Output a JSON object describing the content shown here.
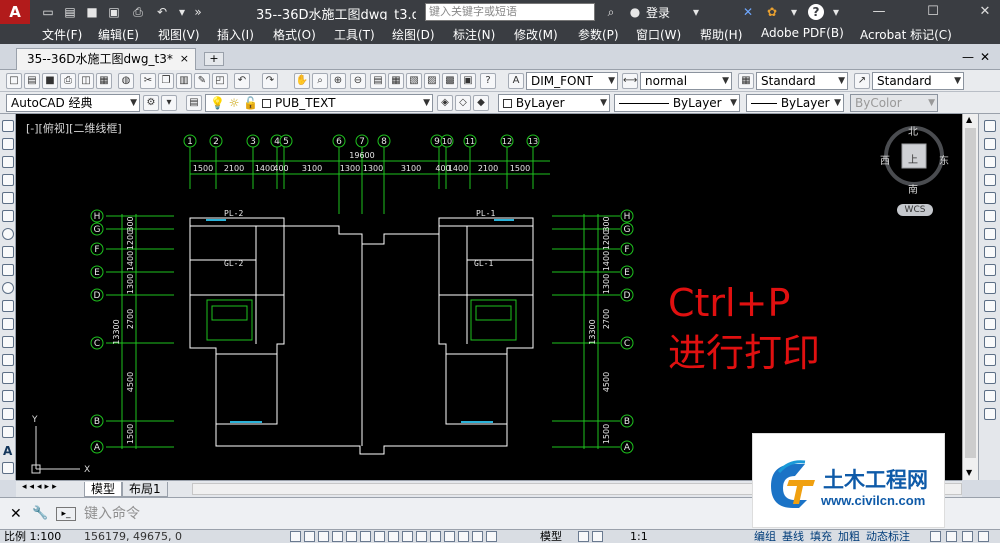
{
  "app": {
    "icon_letter": "A",
    "document_title": "35--36D水施工图dwg_t3.d...",
    "search_placeholder": "键入关键字或短语",
    "sign_in": "登录"
  },
  "menu": [
    "文件(F)",
    "编辑(E)",
    "视图(V)",
    "插入(I)",
    "格式(O)",
    "工具(T)",
    "绘图(D)",
    "标注(N)",
    "修改(M)",
    "参数(P)",
    "窗口(W)",
    "帮助(H)",
    "Adobe PDF(B)",
    "Acrobat 标记(C)"
  ],
  "doc_tab": {
    "label": "35--36D水施工图dwg_t3*",
    "new_tab": "+"
  },
  "toolbar": {
    "dim_style": "DIM_FONT",
    "line_weight_style": "normal",
    "table_style": "Standard",
    "multileader_style": "Standard",
    "workspace": "AutoCAD 经典",
    "layer": "PUB_TEXT",
    "color": "ByLayer",
    "linetype": "ByLayer",
    "lineweight": "ByLayer",
    "plotstyle": "ByColor"
  },
  "viewport_label": "[-][俯视][二维线框]",
  "viewcube": {
    "north": "北",
    "south": "南",
    "east": "东",
    "west": "西",
    "face": "上",
    "wcs": "WCS"
  },
  "drawing": {
    "column_axes": [
      "1",
      "2",
      "3",
      "4",
      "5",
      "6",
      "7",
      "8",
      "9",
      "10",
      "11",
      "12",
      "13"
    ],
    "row_axes": [
      "H",
      "G",
      "F",
      "E",
      "D",
      "C",
      "B",
      "A"
    ],
    "top_total": "19600",
    "top_dims": [
      "1500",
      "2100",
      "1400",
      "400",
      "3100",
      "1300",
      "1300",
      "3100",
      "400",
      "1400",
      "2100",
      "1500"
    ],
    "side_dims": [
      "300",
      "1200",
      "1400",
      "1300",
      "2700",
      "4500",
      "1500"
    ],
    "side_total": "13300",
    "labels": [
      "PL-2",
      "GL-2",
      "PL-1",
      "GL-1"
    ]
  },
  "overlay": {
    "line1": "Ctrl+P",
    "line2": "进行打印"
  },
  "layout_tabs": [
    "模型",
    "布局1"
  ],
  "command": {
    "placeholder": "键入命令"
  },
  "status": {
    "scale": "比例 1:100",
    "coords": "156179, 49675, 0",
    "model": "模型",
    "annot_scale": "1:1",
    "buttons": [
      "编组",
      "基线",
      "填充",
      "加粗",
      "动态标注"
    ]
  },
  "watermark": {
    "cn": "土木工程网",
    "url": "www.civilcn.com"
  }
}
